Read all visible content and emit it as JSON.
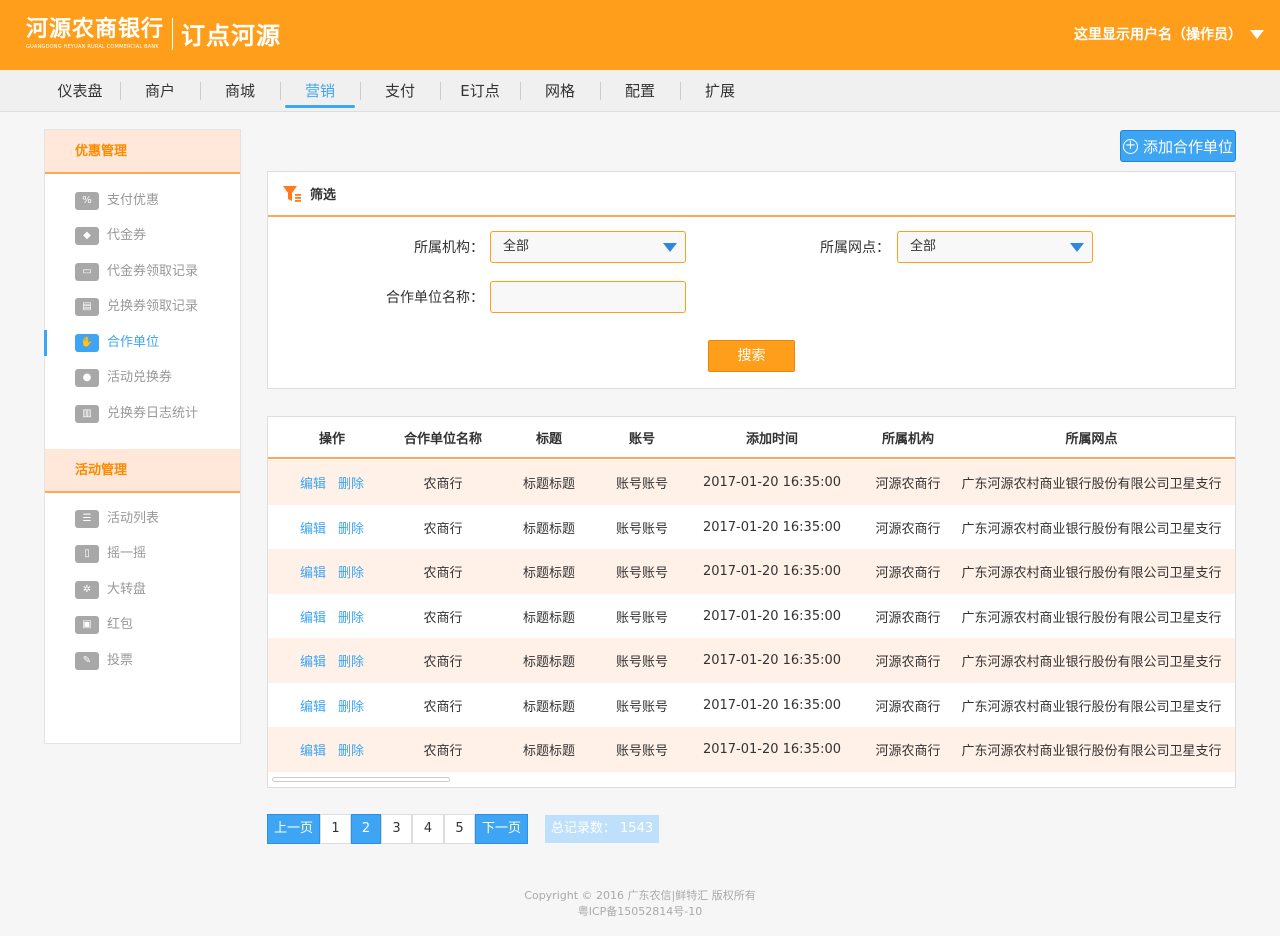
{
  "header": {
    "logo_cn": "河源农商银行",
    "logo_en": "GUANGDONG HEYUAN RURAL COMMERCIAL BANK",
    "logo_sub": "订点河源",
    "username": "这里显示用户名（操作员）",
    "brand_color": "#ff9e1b"
  },
  "nav": {
    "items": [
      "仪表盘",
      "商户",
      "商城",
      "营销",
      "支付",
      "E订点",
      "网格",
      "配置",
      "扩展"
    ],
    "active": "营销",
    "active_color": "#3da5f4"
  },
  "sidebar": {
    "sections": [
      {
        "title": "优惠管理",
        "items": [
          {
            "label": "支付优惠",
            "icon": "percent-icon"
          },
          {
            "label": "代金券",
            "icon": "tag-icon"
          },
          {
            "label": "代金券领取记录",
            "icon": "ticket-icon"
          },
          {
            "label": "兑换券领取记录",
            "icon": "card-icon"
          },
          {
            "label": "合作单位",
            "icon": "handshake-icon",
            "active": true
          },
          {
            "label": "活动兑换券",
            "icon": "coupon-icon"
          },
          {
            "label": "兑换券日志统计",
            "icon": "bar-chart-icon"
          }
        ]
      },
      {
        "title": "活动管理",
        "items": [
          {
            "label": "活动列表",
            "icon": "list-icon"
          },
          {
            "label": "摇一摇",
            "icon": "shake-icon"
          },
          {
            "label": "大转盘",
            "icon": "wheel-icon"
          },
          {
            "label": "红包",
            "icon": "red-packet-icon"
          },
          {
            "label": "投票",
            "icon": "vote-icon"
          }
        ]
      }
    ]
  },
  "toolbar": {
    "add_label": "添加合作单位"
  },
  "filter": {
    "title": "筛选",
    "org_label": "所属机构：",
    "org_value": "全部",
    "branch_label": "所属网点：",
    "branch_value": "全部",
    "name_label": "合作单位名称：",
    "name_value": "",
    "search_label": "搜索"
  },
  "table": {
    "headers": [
      "操作",
      "合作单位名称",
      "标题",
      "账号",
      "添加时间",
      "所属机构",
      "所属网点"
    ],
    "edit_label": "编辑",
    "delete_label": "删除",
    "rows": [
      [
        "农商行",
        "标题标题",
        "账号账号",
        "2017-01-20 16:35:00",
        "河源农商行",
        "广东河源农村商业银行股份有限公司卫星支行"
      ],
      [
        "农商行",
        "标题标题",
        "账号账号",
        "2017-01-20 16:35:00",
        "河源农商行",
        "广东河源农村商业银行股份有限公司卫星支行"
      ],
      [
        "农商行",
        "标题标题",
        "账号账号",
        "2017-01-20 16:35:00",
        "河源农商行",
        "广东河源农村商业银行股份有限公司卫星支行"
      ],
      [
        "农商行",
        "标题标题",
        "账号账号",
        "2017-01-20 16:35:00",
        "河源农商行",
        "广东河源农村商业银行股份有限公司卫星支行"
      ],
      [
        "农商行",
        "标题标题",
        "账号账号",
        "2017-01-20 16:35:00",
        "河源农商行",
        "广东河源农村商业银行股份有限公司卫星支行"
      ],
      [
        "农商行",
        "标题标题",
        "账号账号",
        "2017-01-20 16:35:00",
        "河源农商行",
        "广东河源农村商业银行股份有限公司卫星支行"
      ],
      [
        "农商行",
        "标题标题",
        "账号账号",
        "2017-01-20 16:35:00",
        "河源农商行",
        "广东河源农村商业银行股份有限公司卫星支行"
      ]
    ]
  },
  "pagination": {
    "prev": "上一页",
    "pages": [
      "1",
      "2",
      "3",
      "4",
      "5"
    ],
    "current": "2",
    "next": "下一页",
    "total_text": "总记录数： 1543"
  },
  "footer": {
    "line1": "Copyright © 2016 广东农信|鲜特汇 版权所有",
    "line2": "粤ICP备15052814号-10"
  }
}
